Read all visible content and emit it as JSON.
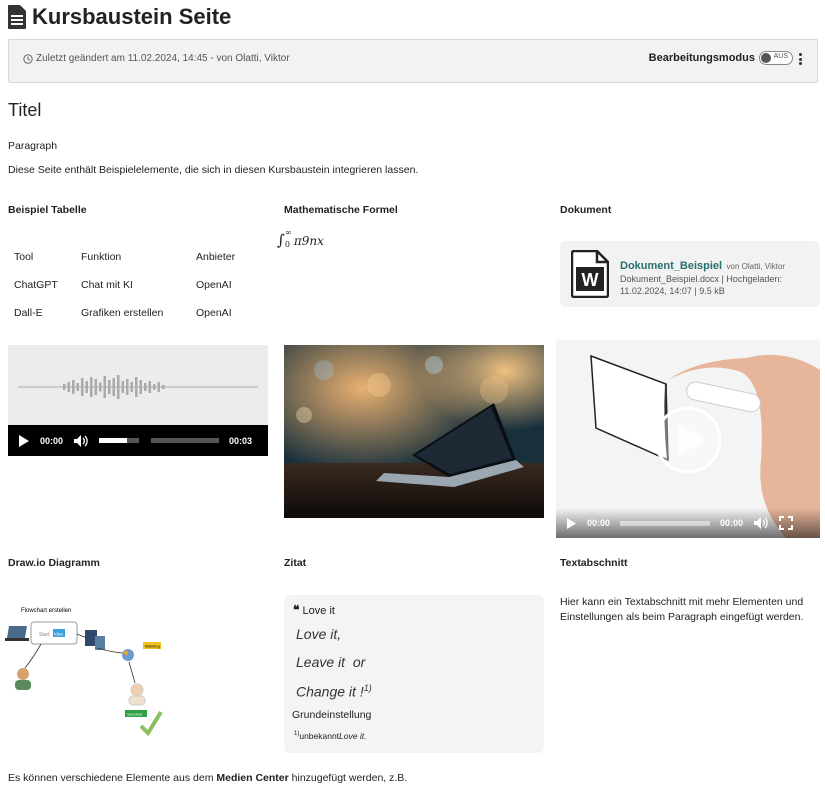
{
  "page": {
    "title": "Kursbaustein Seite",
    "last_modified": "Zuletzt geändert am 11.02.2024, 14:45 - von Olatti, Viktor",
    "edit_mode_label": "Bearbeitungsmodus",
    "edit_mode_state": "AUS"
  },
  "content": {
    "heading": "Titel",
    "paragraph_label": "Paragraph",
    "intro": "Diese Seite enthält Beispielelemente, die sich in diesen Kursbaustein integrieren lassen.",
    "footer_prefix": "Es können verschiedene Elemente aus dem ",
    "footer_bold": "Medien Center",
    "footer_suffix": " hinzugefügt werden, z.B."
  },
  "table_section": {
    "title": "Beispiel Tabelle",
    "rows": [
      [
        "Tool",
        "Funktion",
        "Anbieter"
      ],
      [
        "ChatGPT",
        "Chat mit KI",
        "OpenAI"
      ],
      [
        "Dall-E",
        "Grafiken erstellen",
        "OpenAI"
      ]
    ]
  },
  "formula_section": {
    "title": "Mathematische Formel",
    "integral": "∫",
    "upper": "∞",
    "lower": "0",
    "body": "π9nx"
  },
  "document_section": {
    "title": "Dokument",
    "doc_name": "Dokument_Beispiel",
    "doc_author": "von Olatti, Viktor",
    "doc_meta": "Dokument_Beispiel.docx | Hochgeladen: 11.02.2024, 14:07 | 9.5 kB",
    "doc_icon_letter": "W"
  },
  "audio_player": {
    "current": "00:00",
    "duration": "00:03",
    "volume_level": 0.7
  },
  "video_player": {
    "current": "00:00",
    "duration": "00:00"
  },
  "drawio_section": {
    "title": "Draw.io Diagramm",
    "diagram_title": "Flowchart erstellen",
    "box_label_a": "Start",
    "box_label_b": "Idea",
    "warning": "Warning",
    "success": "Success"
  },
  "quote_section": {
    "title": "Zitat",
    "label": "Love it",
    "lines": [
      "Love it,",
      "Leave it  or",
      "Change it !"
    ],
    "footnote_mark": "1)",
    "setting": "Grundeinstellung",
    "footnote_text_a": "unbekannt",
    "footnote_text_b": "Love it."
  },
  "text_section": {
    "title": "Textabschnitt",
    "body": "Hier kann ein Textabschnitt mit mehr Elementen und Einstellungen als beim Paragraph eingefügt werden."
  },
  "colors": {
    "doc_link": "#2a6f6f",
    "toolbar_bg": "#f2f2f2"
  }
}
